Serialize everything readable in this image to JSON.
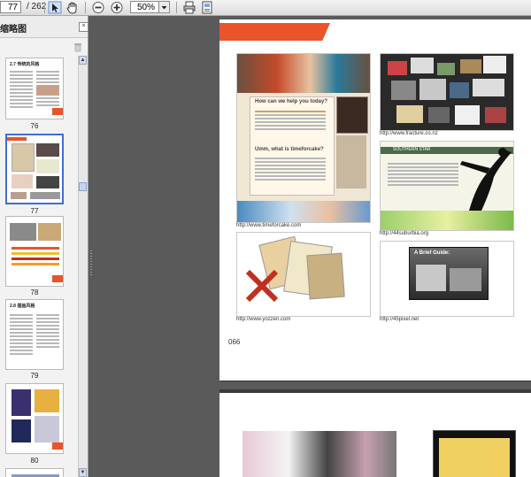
{
  "toolbar": {
    "current_page": "77",
    "total_pages": "/ 262",
    "zoom": "50%",
    "icons": [
      "select-tool-icon",
      "hand-tool-icon",
      "zoom-out-icon",
      "zoom-in-icon",
      "print-icon",
      "fit-page-icon"
    ]
  },
  "thumbnail_panel": {
    "title": "缩略图",
    "close_glyph": "×",
    "thumbnails": [
      {
        "label": "76",
        "heading": "2.7  传统的风格"
      },
      {
        "label": "77"
      },
      {
        "label": "78"
      },
      {
        "label": "79",
        "heading": "2.8  插画风格"
      },
      {
        "label": "80"
      }
    ]
  },
  "page": {
    "captions": [
      "http://www.timeforcake.com",
      "http://www.fracture.co.nz",
      "http://www.yozzen.com",
      "http://44suburbia.org",
      "http://45pixel.net"
    ],
    "page_number": "066",
    "mockup_texts": {
      "card1_heading": "How can we help you today?",
      "card1_heading2": "Umm, what is timeforcake?",
      "card4_heading": "SOUTHERN STAR",
      "card5_heading": "A Brief Guide:"
    }
  },
  "colors": {
    "accent": "#e9542a",
    "doc_background": "#5a5a5a",
    "selection": "#3a6fd8"
  }
}
